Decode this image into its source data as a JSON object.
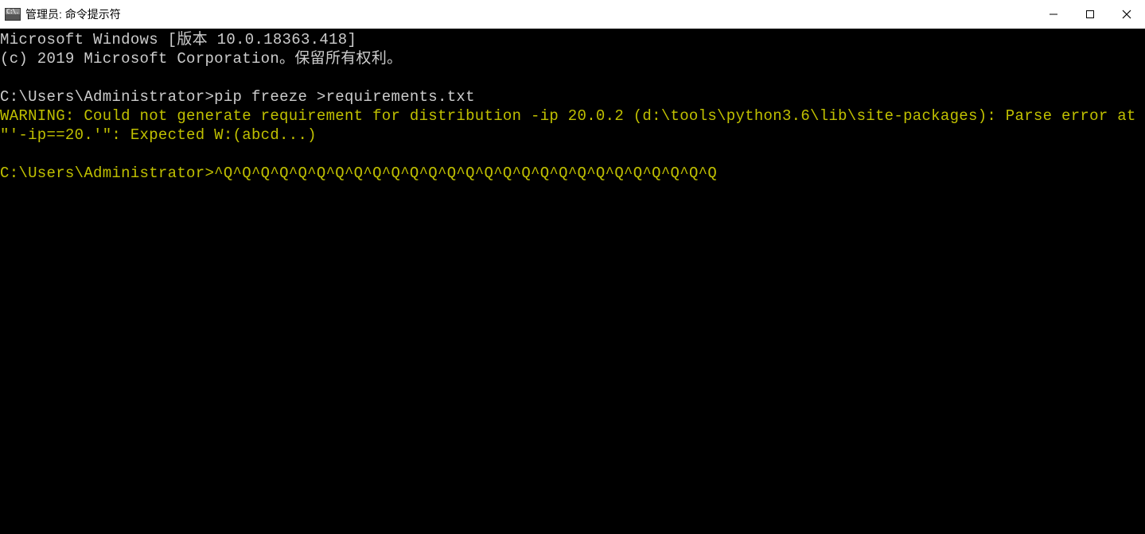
{
  "titlebar": {
    "icon_text": "C:\\.",
    "title": "管理员: 命令提示符"
  },
  "terminal": {
    "line1": "Microsoft Windows [版本 10.0.18363.418]",
    "line2": "(c) 2019 Microsoft Corporation。保留所有权利。",
    "prompt1": "C:\\Users\\Administrator>",
    "cmd1": "pip freeze >requirements.txt",
    "warning": "WARNING: Could not generate requirement for distribution -ip 20.0.2 (d:\\tools\\python3.6\\lib\\site-packages): Parse error at \"'-ip==20.'\": Expected W:(abcd...)",
    "prompt2": "C:\\Users\\Administrator>",
    "cmd2": "^Q^Q^Q^Q^Q^Q^Q^Q^Q^Q^Q^Q^Q^Q^Q^Q^Q^Q^Q^Q^Q^Q^Q^Q^Q^Q^Q"
  }
}
